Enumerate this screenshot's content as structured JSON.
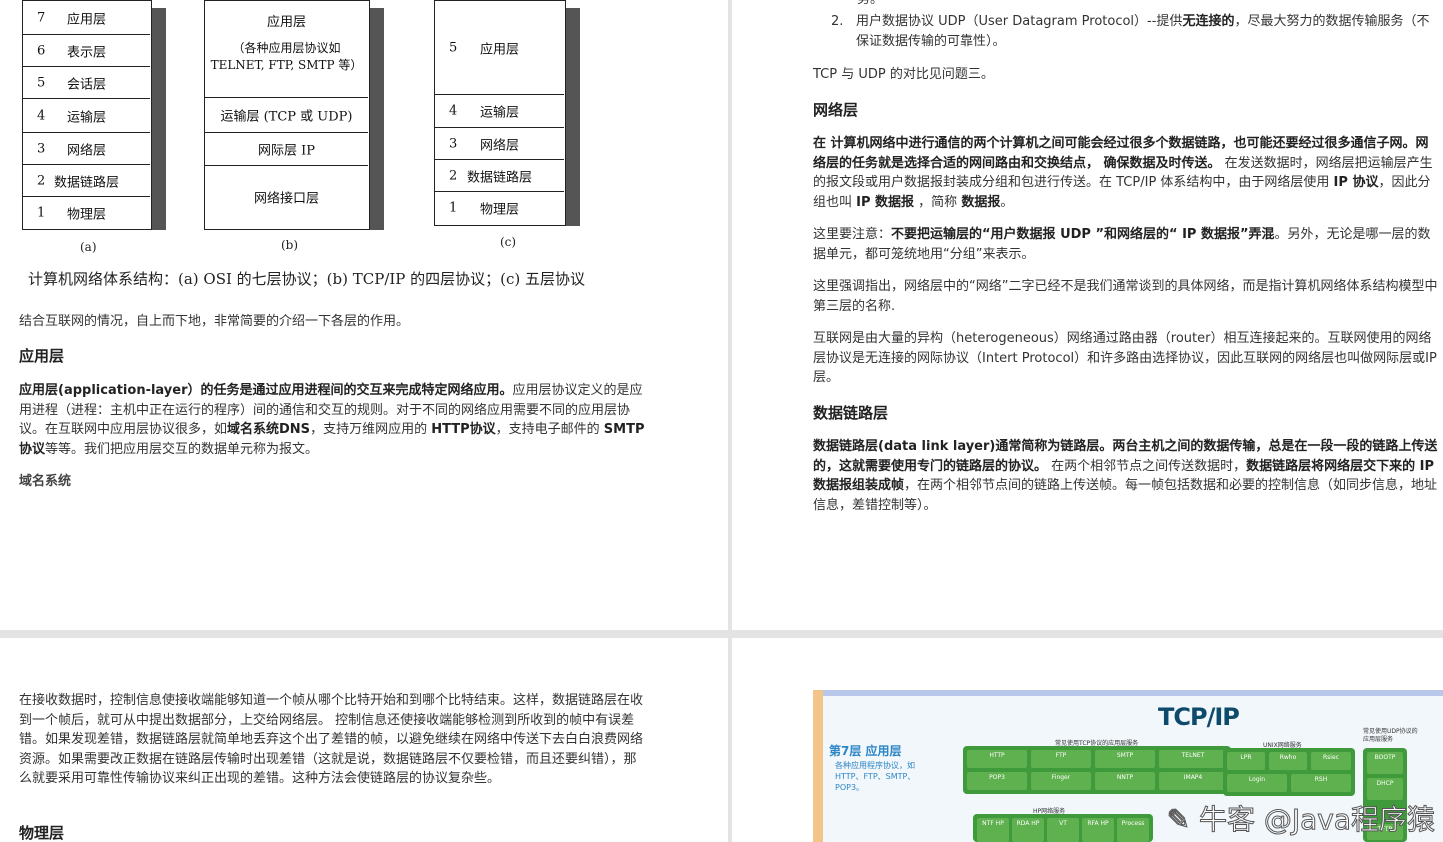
{
  "figure": {
    "osi": {
      "label": "(a)",
      "layers": [
        {
          "num": "7",
          "name": "应用层"
        },
        {
          "num": "6",
          "name": "表示层"
        },
        {
          "num": "5",
          "name": "会话层"
        },
        {
          "num": "4",
          "name": "运输层"
        },
        {
          "num": "3",
          "name": "网络层"
        },
        {
          "num": "2",
          "name": "数据链路层"
        },
        {
          "num": "1",
          "name": "物理层"
        }
      ]
    },
    "tcpip": {
      "label": "(b)",
      "app_title": "应用层",
      "app_desc_1": "（各种应用层协议如",
      "app_desc_2": "TELNET, FTP, SMTP 等）",
      "transport": "运输层 (TCP 或 UDP)",
      "internet": "网际层 IP",
      "link": "网络接口层"
    },
    "five": {
      "label": "(c)",
      "layers": [
        {
          "num": "5",
          "name": "应用层"
        },
        {
          "num": "4",
          "name": "运输层"
        },
        {
          "num": "3",
          "name": "网络层"
        },
        {
          "num": "2",
          "name": "数据链路层"
        },
        {
          "num": "1",
          "name": "物理层"
        }
      ]
    },
    "caption": "计算机网络体系结构：(a) OSI 的七层协议；(b) TCP/IP 的四层协议；(c) 五层协议"
  },
  "page1": {
    "intro": "结合互联网的情况，自上而下地，非常简要的介绍一下各层的作用。",
    "h_app": "应用层",
    "app_p1_bold": "应用层(application-layer）的任务是通过应用进程间的交互来完成特定网络应用。",
    "app_p1_rest1": "应用层协议定义的是应用进程（进程：主机中正在运行的程序）间的通信和交互的规则。对于不同的网络应用需要不同的应用层协议。在互联网中应用层协议很多，如",
    "app_p1_dns": "域名系统DNS",
    "app_p1_rest2": "，支持万维网应用的 ",
    "app_p1_http": "HTTP协议",
    "app_p1_rest3": "，支持电子邮件的 ",
    "app_p1_smtp": "SMTP协议",
    "app_p1_rest4": "等等。我们把应用层交互的数据单元称为报文。",
    "dns_title": "域名系统"
  },
  "page2": {
    "top_fragment": "务。",
    "udp_line_num": "2.",
    "udp_line_a": "用户数据协议 UDP（User Datagram Protocol）--提供",
    "udp_line_bold": "无连接的",
    "udp_line_b": "，尽最大努力的数据传输服务（不保证数据传输的可靠性）。",
    "compare": "TCP 与 UDP 的对比见问题三。",
    "h_net": "网络层",
    "net_p1_bold1": "在 计算机网络中进行通信的两个计算机之间可能会经过很多个数据链路，也可能还要经过很多通信子网。网络层的任务就是选择合适的网间路由和交换结点，  确保数据及时传送。",
    "net_p1_rest": " 在发送数据时，网络层把运输层产生的报文段或用户数据报封装成分组和包进行传送。在 TCP/IP 体系结构中，由于网络层使用 ",
    "net_p1_ip": "IP 协议",
    "net_p1_rest2": "，因此分组也叫 ",
    "net_p1_ipdg": "IP 数据报",
    "net_p1_rest3": " ，简称 ",
    "net_p1_dg": "数据报",
    "net_p1_end": "。",
    "net_p2_a": "这里要注意：",
    "net_p2_bold": "不要把运输层的“用户数据报 UDP ”和网络层的“ IP 数据报”弄混",
    "net_p2_b": "。另外，无论是哪一层的数据单元，都可笼统地用“分组”来表示。",
    "net_p3": "这里强调指出，网络层中的“网络”二字已经不是我们通常谈到的具体网络，而是指计算机网络体系结构模型中第三层的名称.",
    "net_p4": "互联网是由大量的异构（heterogeneous）网络通过路由器（router）相互连接起来的。互联网使用的网络层协议是无连接的网际协议（Intert Protocol）和许多路由选择协议，因此互联网的网络层也叫做网际层或IP层。",
    "h_link": "数据链路层",
    "link_p1_bold1": "数据链路层(data link layer)通常简称为链路层。两台主机之间的数据传输，总是在一段一段的链路上传送的，这就需要使用专门的链路层的协议。",
    "link_p1_rest1": " 在两个相邻节点之间传送数据时，",
    "link_p1_bold2": "数据链路层将网络层交下来的 IP 数据报组装成帧",
    "link_p1_rest2": "，在两个相邻节点间的链路上传送帧。每一帧包括数据和必要的控制信息（如同步信息，地址信息，差错控制等）。"
  },
  "page3": {
    "p1": "在接收数据时，控制信息使接收端能够知道一个帧从哪个比特开始和到哪个比特结束。这样，数据链路层在收到一个帧后，就可从中提出数据部分，上交给网络层。 控制信息还使接收端能够检测到所收到的帧中有误差错。如果发现差错，数据链路层就简单地丢弃这个出了差错的帧，以避免继续在网络中传送下去白白浪费网络资源。如果需要改正数据在链路层传输时出现差错（这就是说，数据链路层不仅要检错，而且还要纠错），那么就要采用可靠性传输协议来纠正出现的差错。这种方法会使链路层的协议复杂些。",
    "h_phys": "物理层"
  },
  "poster": {
    "title": "TCP/IP",
    "layer7_title": "第7层  应用层",
    "layer7_desc": "各种应用程序协议，如HTTP、FTP、SMTP、POP3。",
    "group1_label": "常见使用TCP协议的应用层服务",
    "group2_label": "UNIX网络服务",
    "group3_label": "常见使用UDP协议的应用层服务",
    "group4_label": "HP网络服务",
    "cells1": [
      "HTTP",
      "FTP",
      "SMTP",
      "TELNET",
      "POP3",
      "Finger",
      "NNTP",
      "IMAP4"
    ],
    "cells2": [
      "LPR",
      "Rwho",
      "Rsiec",
      "Login",
      "RSH"
    ],
    "cells3": [
      "BOOTP",
      "DHCP",
      "TFTP"
    ],
    "cells4": [
      "NTF HP",
      "RDA HP",
      "VT",
      "RFA HP",
      "Process"
    ],
    "watermark": "✎ 牛客 @Java程序猿"
  },
  "colors": {
    "accent": "#2d86c6",
    "poster_green": "#3e9a3a",
    "title_blue": "#0d4a6b"
  }
}
